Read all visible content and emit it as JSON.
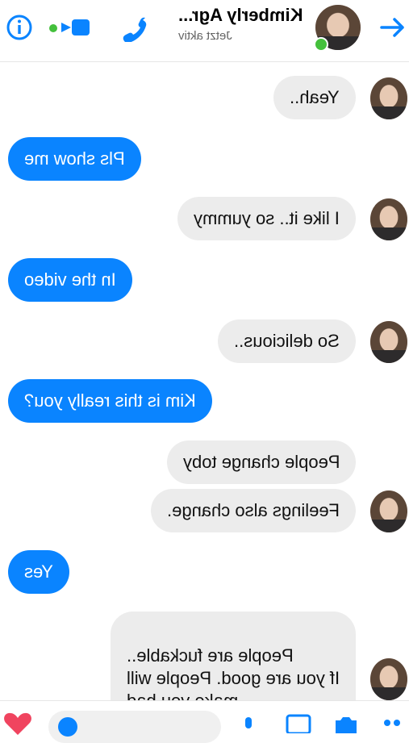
{
  "header": {
    "title": "Kimberly Agr...",
    "status": "Jetzt aktiv",
    "icons": [
      "info-icon",
      "video-call-icon",
      "phone-icon",
      "back-arrow-icon"
    ],
    "accent": "#0a84ff",
    "online_color": "#44c03c"
  },
  "messages": [
    {
      "side": "in",
      "text": "Yeah.."
    },
    {
      "side": "out",
      "text": "Pls show me"
    },
    {
      "side": "in",
      "text": "I like it.. so yummy"
    },
    {
      "side": "out",
      "text": "In the video"
    },
    {
      "side": "in",
      "text": "So delicious.."
    },
    {
      "side": "out",
      "text": "Kim is this really you?"
    },
    {
      "side": "in",
      "text": "People change toby"
    },
    {
      "side": "in",
      "text": "Feelings also change."
    },
    {
      "side": "out",
      "text": "Yes"
    },
    {
      "side": "in",
      "text": "People are fuckable..\nIf you are good. People will\nmake you bad"
    }
  ],
  "bottom": {
    "icons": [
      "heart-icon",
      "message-input",
      "mic-icon",
      "image-icon",
      "camera-icon",
      "menu-icon"
    ]
  }
}
